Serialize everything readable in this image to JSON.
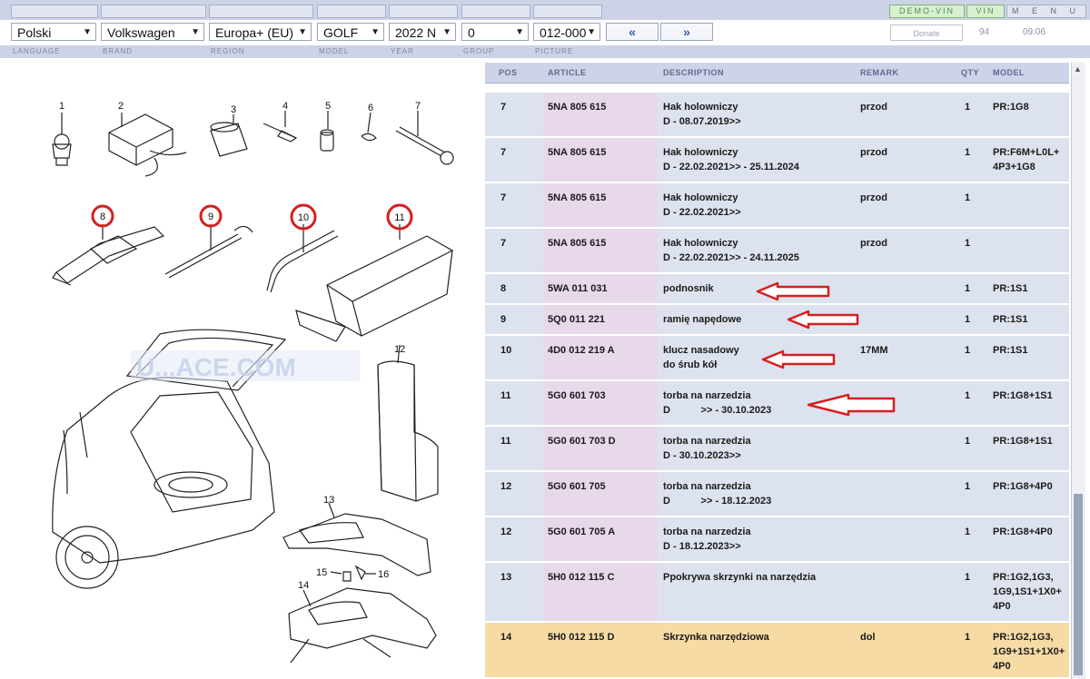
{
  "header": {
    "demo_vin": "DEMO-VIN",
    "vin": "VIN",
    "menu": "M E N U"
  },
  "selectors": {
    "language": "Polski",
    "brand": "Volkswagen",
    "region": "Europa+ (EU)",
    "model": "GOLF",
    "year": "2022 N",
    "group": "0",
    "picture": "012-000",
    "prev": "«",
    "next": "»"
  },
  "toolbar": {
    "donate": "Donate",
    "count": "94",
    "time": "09:06"
  },
  "labels": {
    "language": "LANGUAGE",
    "brand": "BRAND",
    "region": "REGION",
    "model": "MODEL",
    "year": "YEAR",
    "group": "GROUP",
    "picture": "PICTURE"
  },
  "diagram": {
    "watermark": "U...ACE.COM",
    "callouts": [
      "1",
      "2",
      "3",
      "4",
      "5",
      "6",
      "7",
      "8",
      "9",
      "10",
      "11",
      "12",
      "13",
      "14",
      "15",
      "16"
    ],
    "highlight_color": "#d42020"
  },
  "table": {
    "columns": {
      "pos": "POS",
      "article": "ARTICLE",
      "description": "DESCRIPTION",
      "remark": "REMARK",
      "qty": "QTY",
      "model": "MODEL"
    },
    "rows": [
      {
        "pos": "7",
        "article": "5NA 805 615",
        "description": "Hak holowniczy\nD - 08.07.2019>>",
        "remark": "przod",
        "qty": "1",
        "model": "PR:1G8"
      },
      {
        "pos": "7",
        "article": "5NA 805 615",
        "description": "Hak holowniczy\nD - 22.02.2021>> - 25.11.2024",
        "remark": "przod",
        "qty": "1",
        "model": "PR:F6M+L0L+\n4P3+1G8"
      },
      {
        "pos": "7",
        "article": "5NA 805 615",
        "description": "Hak holowniczy\nD - 22.02.2021>>",
        "remark": "przod",
        "qty": "1",
        "model": ""
      },
      {
        "pos": "7",
        "article": "5NA 805 615",
        "description": "Hak holowniczy\nD - 22.02.2021>> - 24.11.2025",
        "remark": "przod",
        "qty": "1",
        "model": ""
      },
      {
        "pos": "8",
        "article": "5WA 011 031",
        "description": "podnosnik",
        "remark": "",
        "qty": "1",
        "model": "PR:1S1"
      },
      {
        "pos": "9",
        "article": "5Q0 011 221",
        "description": "ramię napędowe",
        "remark": "",
        "qty": "1",
        "model": "PR:1S1"
      },
      {
        "pos": "10",
        "article": "4D0 012 219 A",
        "description": "klucz nasadowy\ndo śrub kół",
        "remark": "17MM",
        "qty": "1",
        "model": "PR:1S1"
      },
      {
        "pos": "11",
        "article": "5G0 601 703",
        "description": "torba na narzedzia\nD           >> - 30.10.2023",
        "remark": "",
        "qty": "1",
        "model": "PR:1G8+1S1"
      },
      {
        "pos": "11",
        "article": "5G0 601 703 D",
        "description": "torba na narzedzia\nD - 30.10.2023>>",
        "remark": "",
        "qty": "1",
        "model": "PR:1G8+1S1"
      },
      {
        "pos": "12",
        "article": "5G0 601 705",
        "description": "torba na narzedzia\nD           >> - 18.12.2023",
        "remark": "",
        "qty": "1",
        "model": "PR:1G8+4P0"
      },
      {
        "pos": "12",
        "article": "5G0 601 705 A",
        "description": "torba na narzedzia\nD - 18.12.2023>>",
        "remark": "",
        "qty": "1",
        "model": "PR:1G8+4P0"
      },
      {
        "pos": "13",
        "article": "5H0 012 115 C",
        "description": "Ppokrywa skrzynki na narzędzia",
        "remark": "",
        "qty": "1",
        "model": "PR:1G2,1G3,\n1G9,1S1+1X0+\n4P0"
      },
      {
        "pos": "14",
        "article": "5H0 012 115 D",
        "description": "Skrzynka narzędziowa",
        "remark": "dol",
        "qty": "1",
        "model": "PR:1G2,1G3,\n1G9+1S1+1X0+\n4P0"
      }
    ]
  }
}
